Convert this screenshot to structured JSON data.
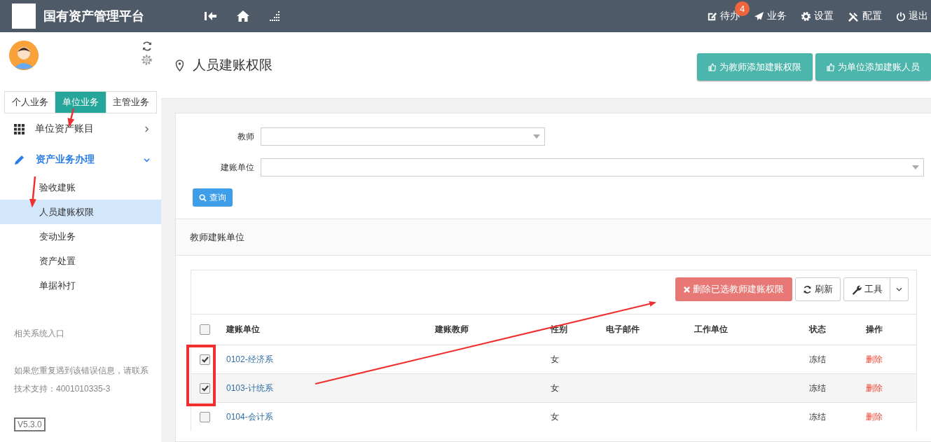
{
  "header": {
    "title": "国有资产管理平台",
    "nav": [
      {
        "kind": "todo",
        "label": "待办",
        "badge": "4"
      },
      {
        "kind": "business",
        "label": "业务"
      },
      {
        "kind": "settings",
        "label": "设置"
      },
      {
        "kind": "config",
        "label": "配置"
      },
      {
        "kind": "logout",
        "label": "退出"
      }
    ]
  },
  "sidebar": {
    "tabs": [
      {
        "label": "个人业务",
        "selected": false
      },
      {
        "label": "单位业务",
        "selected": true
      },
      {
        "label": "主管业务",
        "selected": false
      }
    ],
    "menu": [
      {
        "kind": "grid",
        "label": "单位资产账目",
        "expanded": false
      },
      {
        "kind": "pencil",
        "label": "资产业务办理",
        "expanded": true,
        "children": [
          {
            "label": "验收建账",
            "selected": false
          },
          {
            "label": "人员建账权限",
            "selected": true
          },
          {
            "label": "变动业务",
            "selected": false
          },
          {
            "label": "资产处置",
            "selected": false
          },
          {
            "label": "单据补打",
            "selected": false
          }
        ]
      }
    ],
    "links_title": "相关系统入口",
    "support": "如果您重复遇到该错误信息，请联系技术支持：4001010335-3",
    "version": "V5.3.0"
  },
  "page": {
    "title": "人员建账权限",
    "actions": [
      "为教师添加建账权限",
      "为单位添加建账人员"
    ],
    "filters": [
      {
        "label": "教师",
        "wide": false
      },
      {
        "label": "建账单位",
        "wide": true
      }
    ],
    "search_button": "查询",
    "section_title": "教师建账单位",
    "toolbar": {
      "delete": "删除已选教师建账权限",
      "refresh": "刷新",
      "tools": "工具"
    },
    "table": {
      "all_checked": false,
      "columns": [
        "建账单位",
        "建账教师",
        "性别",
        "电子邮件",
        "工作单位",
        "状态",
        "操作"
      ],
      "rows": [
        {
          "checked": true,
          "unit": "0102-经济系",
          "gender": "女",
          "status": "冻结",
          "action": "删除"
        },
        {
          "checked": true,
          "unit": "0103-计统系",
          "gender": "女",
          "status": "冻结",
          "action": "删除"
        },
        {
          "checked": false,
          "unit": "0104-会计系",
          "gender": "女",
          "status": "冻结",
          "action": "删除"
        }
      ]
    }
  }
}
